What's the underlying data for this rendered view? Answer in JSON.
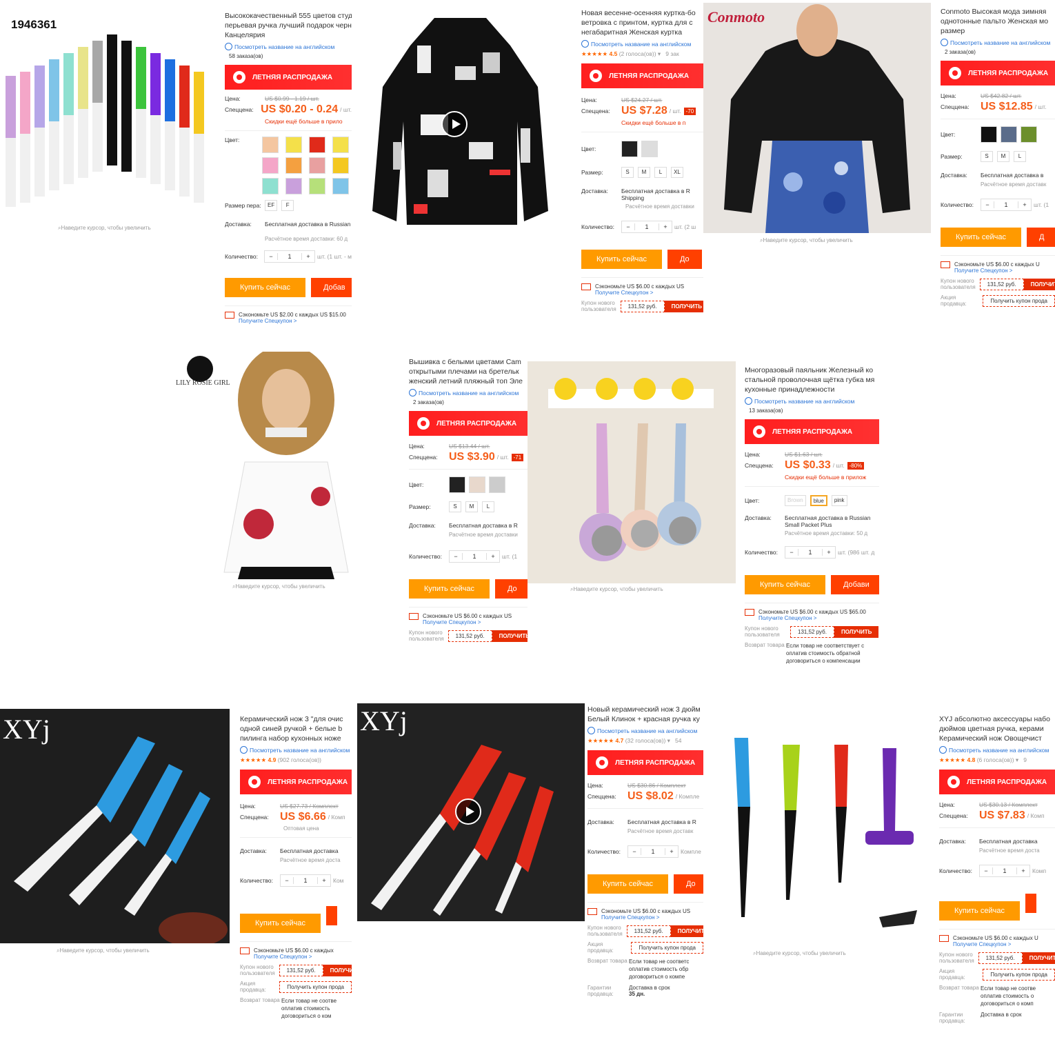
{
  "labels": {
    "price": "Цена:",
    "special": "Спеццена:",
    "color": "Цвет:",
    "size": "Размер:",
    "pen_size": "Размер пера:",
    "delivery": "Доставка:",
    "qty": "Количество:",
    "translate": "Посмотреть название на английском",
    "sale": "ЛЕТНЯЯ РАСПРОДАЖА",
    "hover": "Наведите курсор, чтобы увеличить",
    "buy": "Купить сейчас",
    "coupon_link": "Получите Спецкупон >",
    "new_coupon": "Купон нового пользователя",
    "coupon_val": "131,52 руб.",
    "get": "ПОЛУЧИТЬ",
    "seller_promo": "Акция продавца:",
    "seller_promo_btn": "Получить купон прода",
    "return": "Возврат товара",
    "guarantee": "Гарантии продавца:"
  },
  "p1": {
    "watermark": "1946361",
    "title": "Высококачественный 555 цветов студ перьевая ручка лучший подарок черн Канцелярия",
    "orders": "58 заказа(ов)",
    "old": "US $0.99 - 1.19 / шт.",
    "new": "US $0.20 - 0.24",
    "unit": "/ шт.",
    "more": "Скидки ещё больше в прило",
    "sizes": [
      "EF",
      "F"
    ],
    "delivery": "Бесплатная доставка в Russian",
    "eta": "Расчётное время доставки: 60 д",
    "qunit": "шт. (1 шт. - м",
    "add": "Добав",
    "coupon": "Сэкономьте US $2.00 с каждых US $15.00"
  },
  "p2": {
    "title": "Новая весенне-осенняя куртка-бо ветровка с принтом, куртка для с негабаритная Женская куртка",
    "rating": "4.5",
    "votes": "(2 голоса(ов))",
    "sold": "9 зак",
    "old": "US $24.27 / шт.",
    "new": "US $7.28",
    "unit": "/ шт.",
    "disc": "-70",
    "more": "Скидки ещё больше в п",
    "sizes": [
      "S",
      "M",
      "L",
      "XL"
    ],
    "delivery": "Бесплатная доставка в R Shipping",
    "eta": "Расчётное время доставки",
    "qunit": "шт. (2 ш",
    "add": "До",
    "coupon": "Сэкономьте US $6.00 с каждых US"
  },
  "p3": {
    "brand": "Conmoto",
    "title": "Conmoto Высокая мода зимняя однотонные пальто Женская мо размер",
    "orders": "2 заказа(ов)",
    "old": "US $42.82 / шт.",
    "new": "US $12.85",
    "unit": "/ шт.",
    "sizes": [
      "S",
      "M",
      "L"
    ],
    "delivery": "Бесплатная доставка в",
    "eta": "Расчётное время доставк",
    "qunit": "шт. (1",
    "add": "Д",
    "coupon": "Сэкономьте US $6.00 с каждых U"
  },
  "p4": {
    "brand": "LILY ROSIE GIRL",
    "title": "Вышивка с белыми цветами Cam открытыми плечами на бретельк женский летний пляжный топ Эле",
    "orders": "2 заказа(ов)",
    "old": "US $13.44 / шт.",
    "new": "US $3.90",
    "unit": "/ шт.",
    "disc": "-71",
    "sizes": [
      "S",
      "M",
      "L"
    ],
    "delivery": "Бесплатная доставка в R",
    "eta": "Расчётное время доставки",
    "qunit": "шт. (1",
    "add": "До",
    "coupon": "Сэкономьте US $6.00 с каждых US"
  },
  "p5": {
    "title": "Многоразовый паяльник Железный ко стальной проволочная щётка губка мя кухонные принадлежности",
    "orders": "13 заказа(ов)",
    "old": "US $1.63 / шт.",
    "new": "US $0.33",
    "unit": "/ шт.",
    "disc": "-80%",
    "more": "Скидки ещё больше в прилож",
    "colors": [
      "Brown",
      "blue",
      "pink"
    ],
    "delivery": "Бесплатная доставка в Russian Small Packet Plus",
    "eta": "Расчётное время доставки: 50 д",
    "qunit": "шт. (986 шт. д",
    "add": "Добави",
    "coupon": "Сэкономьте US $6.00 с каждых US $65.00",
    "note": "Если товар не соответствует с оплатив стоимость обратной договориться о компенсации"
  },
  "p6": {
    "brand": "XYj",
    "title": "Керамический нож 3 \"для очис одной синей ручкой + белые b пилинга набор кухонных ноже",
    "rating": "4.9",
    "votes": "(902 голоса(ов))",
    "old": "US $27.73 / Комплект",
    "new": "US $6.66",
    "unit": "/ Комп",
    "wholesale": "Оптовая цена",
    "delivery": "Бесплатная доставка",
    "eta": "Расчётное время доста",
    "qunit": "Ком",
    "add": "",
    "coupon": "Сэкономьте US $6.00 с каждых",
    "note": "Если товар не соотве оплатив стоимость договориться о ком"
  },
  "p7": {
    "brand": "XYj",
    "title": "Новый керамический нож 3 дюйм Белый Клинок + красная ручка ку",
    "rating": "4.7",
    "votes": "(32 голоса(ов))",
    "sold": "54",
    "old": "US $30.86 / Комплект",
    "new": "US $8.02",
    "unit": "/ Компле",
    "delivery": "Бесплатная доставка в R",
    "eta": "Расчётное время доставк",
    "qunit": "Компле",
    "add": "До",
    "coupon": "Сэкономьте US $6.00 с каждых US",
    "note": "Если товар не соответс оплатив стоимость обр договориться о компе",
    "ship": "Доставка в срок",
    "days": "35 дн."
  },
  "p8": {
    "title": "XYJ абсолютно аксессуары набо дюймов цветная ручка, керами Керамический нож Овощечист",
    "rating": "4.8",
    "votes": "(6 голоса(ов))",
    "sold": "9",
    "old": "US $30.13 / Комплект",
    "new": "US $7.83",
    "unit": "/ Комп",
    "delivery": "Бесплатная доставка",
    "eta": "Расчётное время доста",
    "qunit": "Комп",
    "coupon": "Сэкономьте US $6.00 с каждых U",
    "note": "Если товар не соотве оплатив стоимость о договориться о комп",
    "ship": "Доставка в срок"
  }
}
